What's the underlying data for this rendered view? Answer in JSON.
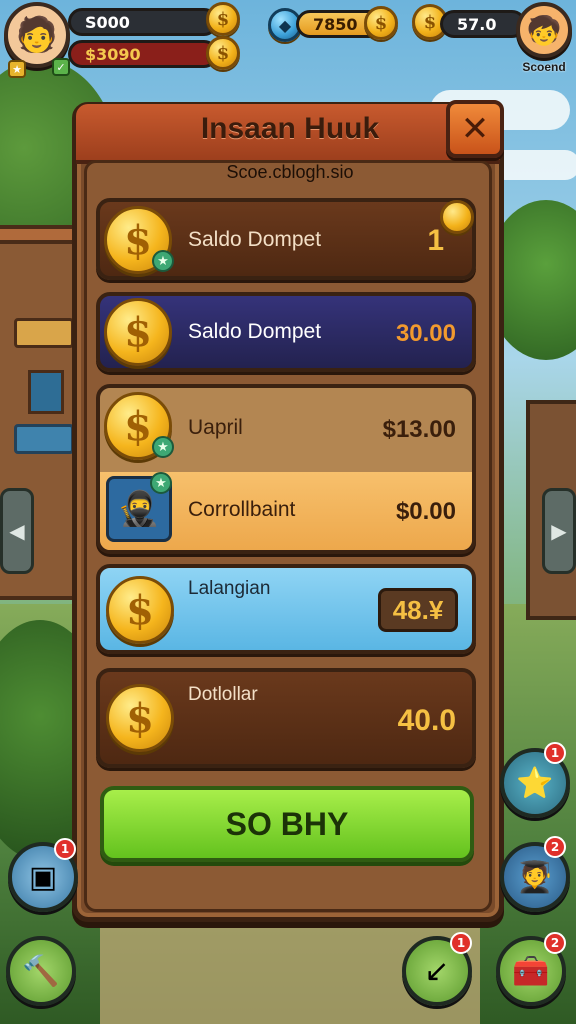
{
  "hud": {
    "player_left": {
      "top_value": "S000",
      "bottom_value": "$3090",
      "avatar_icon": "player-avatar"
    },
    "coins_center": {
      "value": "7850",
      "coin_symbol": "$"
    },
    "coins_right": {
      "value": "57.0",
      "player_name": "Scoend"
    }
  },
  "panel": {
    "title": "Insaan Huuk",
    "subtitle": "Scoe.cblogh.sio",
    "close_label": "✕",
    "rows": [
      {
        "label": "Saldo Dompet",
        "value": "1",
        "coin_symbol": "$"
      },
      {
        "label": "Saldo Dompet",
        "value": "30.00",
        "coin_symbol": "$"
      },
      {
        "label": "Uapril",
        "value": "$13.00",
        "coin_symbol": "$"
      },
      {
        "label": "Corrollbaint",
        "value": "$0.00"
      },
      {
        "label": "Lalangian",
        "value": "48.¥",
        "coin_symbol": "$"
      },
      {
        "label": "Dotlollar",
        "value": "40.0",
        "coin_symbol": "$"
      }
    ],
    "buy_label": "SO BHY"
  },
  "side": {
    "left_arrow": "◀",
    "right_arrow": "▶"
  },
  "bottom": {
    "notif_1": "1",
    "notif_2": "2",
    "notif_3": "1",
    "notif_4": "1",
    "notif_5": "2"
  },
  "colors": {
    "panel": "#7a4b2a",
    "header": "#c85a2e",
    "row_brown": "#5a3018",
    "row_navy": "#2b2a5e",
    "row_tan": "#b88b57",
    "row_orange": "#f1b25c",
    "row_blue": "#6cc3ec",
    "buy_green": "#8bdc36"
  }
}
